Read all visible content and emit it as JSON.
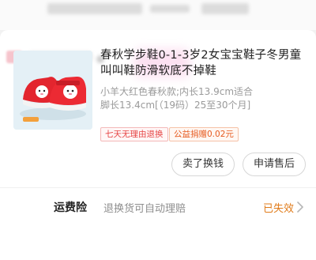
{
  "product": {
    "title": "春秋学步鞋0-1-3岁2女宝宝鞋子冬男童叫叫鞋防滑软底不掉鞋",
    "sku": "小羊大红色春秋款;内长13.9cm适合脚长13.4cm[（19码）25至30个月]",
    "tags": {
      "return_policy": "七天无理由退换",
      "charity": "公益捐赠0.02元"
    }
  },
  "actions": {
    "exchange_label": "卖了换钱",
    "aftersale_label": "申请售后"
  },
  "freight_insurance": {
    "label": "运费险",
    "description": "退换货可自动理赔",
    "status": "已失效"
  },
  "colors": {
    "accent_red": "#e64545",
    "accent_orange": "#e07b1a",
    "charity_orange": "#e65a1f"
  },
  "icons": {
    "shop": "shop-icon",
    "chevron": "chevron-right-icon"
  }
}
